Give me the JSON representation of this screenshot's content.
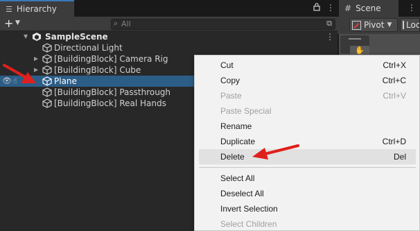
{
  "hierarchy": {
    "tab_label": "Hierarchy",
    "search_placeholder": "All",
    "scene_name": "SampleScene",
    "items": [
      {
        "label": "Directional Light"
      },
      {
        "label": "[BuildingBlock] Camera Rig"
      },
      {
        "label": "[BuildingBlock] Cube"
      },
      {
        "label": "Plane"
      },
      {
        "label": "[BuildingBlock] Passthrough"
      },
      {
        "label": "[BuildingBlock] Real Hands"
      }
    ]
  },
  "scene_panel": {
    "tab_label": "Scene",
    "pivot_label": "Pivot",
    "local_label": "Local"
  },
  "context_menu": {
    "items": [
      {
        "label": "Cut",
        "shortcut": "Ctrl+X"
      },
      {
        "label": "Copy",
        "shortcut": "Ctrl+C"
      },
      {
        "label": "Paste",
        "shortcut": "Ctrl+V"
      },
      {
        "label": "Paste Special",
        "shortcut": ""
      },
      {
        "label": "Rename",
        "shortcut": ""
      },
      {
        "label": "Duplicate",
        "shortcut": "Ctrl+D"
      },
      {
        "label": "Delete",
        "shortcut": "Del"
      },
      {
        "label": "Select All",
        "shortcut": ""
      },
      {
        "label": "Deselect All",
        "shortcut": ""
      },
      {
        "label": "Invert Selection",
        "shortcut": ""
      },
      {
        "label": "Select Children",
        "shortcut": ""
      }
    ]
  },
  "colors": {
    "selection": "#2c5d87",
    "annotation_arrow": "#e0201c",
    "panel_bg": "#282828",
    "menu_bg": "#f2f2f2"
  }
}
